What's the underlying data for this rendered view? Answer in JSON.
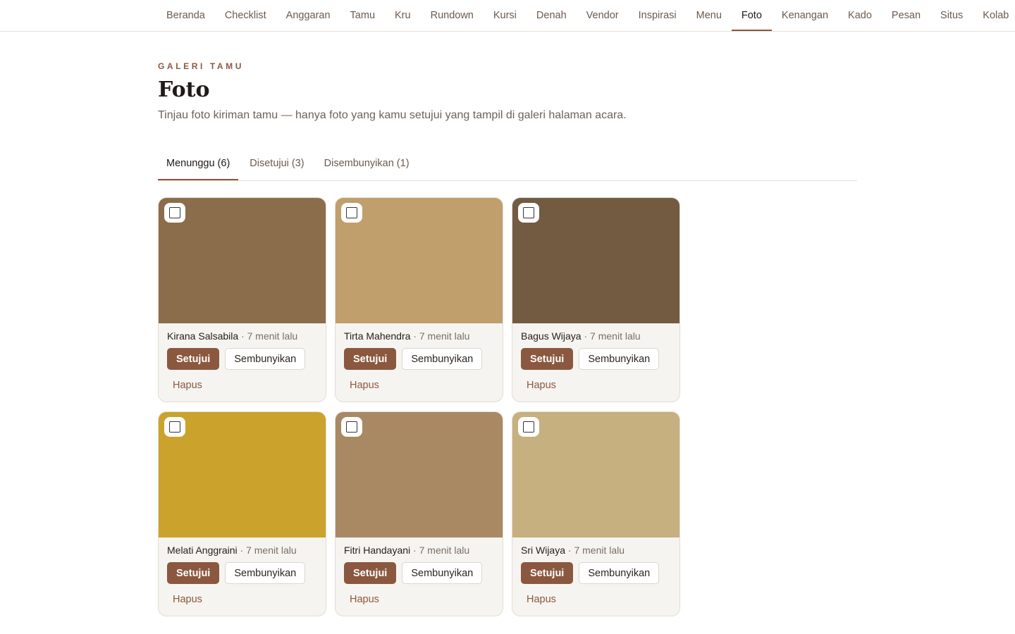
{
  "nav": {
    "items": [
      "Beranda",
      "Checklist",
      "Anggaran",
      "Tamu",
      "Kru",
      "Rundown",
      "Kursi",
      "Denah",
      "Vendor",
      "Inspirasi",
      "Menu",
      "Foto",
      "Kenangan",
      "Kado",
      "Pesan",
      "Situs",
      "Kolab"
    ],
    "active": "Foto"
  },
  "header": {
    "eyebrow": "GALERI TAMU",
    "title": "Foto",
    "subtitle": "Tinjau foto kiriman tamu — hanya foto yang kamu setujui yang tampil di galeri halaman acara."
  },
  "tabs": [
    {
      "label": "Menunggu (6)",
      "active": true
    },
    {
      "label": "Disetujui (3)",
      "active": false
    },
    {
      "label": "Disembunyikan (1)",
      "active": false
    }
  ],
  "actions": {
    "approve_label": "Setujui",
    "hide_label": "Sembunyikan",
    "delete_label": "Hapus"
  },
  "photos": [
    {
      "name": "Kirana Salsabila",
      "time": "7 menit lalu",
      "color": "#8b6d4c",
      "selected": false
    },
    {
      "name": "Tirta Mahendra",
      "time": "7 menit lalu",
      "color": "#c09f6d",
      "selected": false
    },
    {
      "name": "Bagus Wijaya",
      "time": "7 menit lalu",
      "color": "#735b41",
      "selected": false
    },
    {
      "name": "Melati Anggraini",
      "time": "7 menit lalu",
      "color": "#cba22b",
      "selected": false
    },
    {
      "name": "Fitri Handayani",
      "time": "7 menit lalu",
      "color": "#a88964",
      "selected": false
    },
    {
      "name": "Sri Wijaya",
      "time": "7 menit lalu",
      "color": "#c6b080",
      "selected": false
    }
  ],
  "colors": {
    "accent": "#8b583f",
    "card_bg": "#f6f4f0"
  }
}
